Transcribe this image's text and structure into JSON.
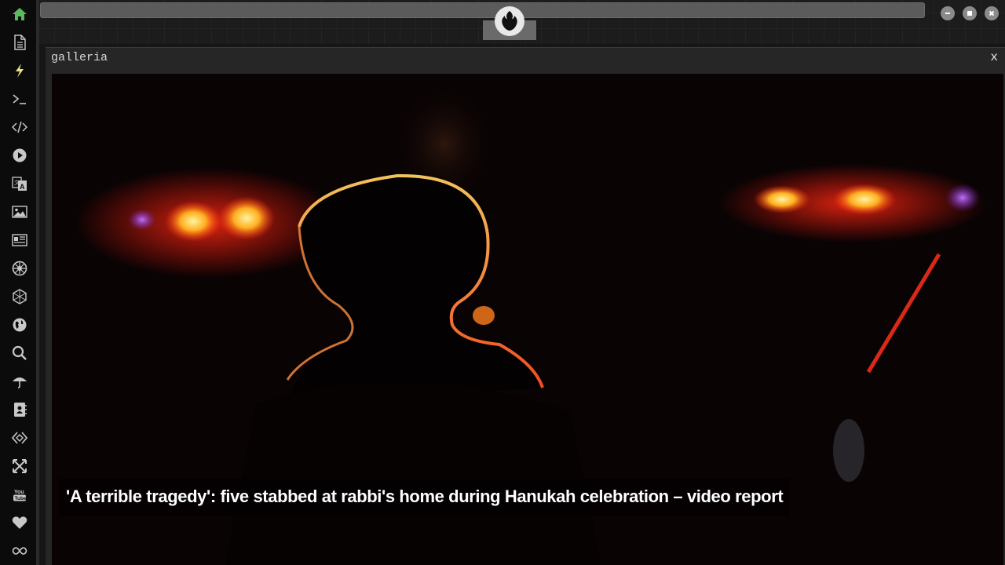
{
  "sidebar": {
    "items": [
      {
        "icon": "home-icon",
        "color": "#5cb85c"
      },
      {
        "icon": "document-icon"
      },
      {
        "icon": "lightning-icon",
        "color": "#f0e28a"
      },
      {
        "icon": "terminal-icon"
      },
      {
        "icon": "code-icon"
      },
      {
        "icon": "play-icon"
      },
      {
        "icon": "translate-icon"
      },
      {
        "icon": "image-icon"
      },
      {
        "icon": "news-icon"
      },
      {
        "icon": "empire-icon"
      },
      {
        "icon": "hexagon-icon"
      },
      {
        "icon": "globe-icon"
      },
      {
        "icon": "search-icon"
      },
      {
        "icon": "umbrella-icon"
      },
      {
        "icon": "address-book-icon"
      },
      {
        "icon": "diamond-code-icon"
      },
      {
        "icon": "expand-icon"
      },
      {
        "icon": "youtube-icon"
      },
      {
        "icon": "heart-icon"
      },
      {
        "icon": "infinity-icon"
      }
    ]
  },
  "topbar": {
    "address_value": "",
    "logo_icon": "rebel-alliance-icon"
  },
  "window": {
    "title": "galleria",
    "close_label": "x"
  },
  "gallery": {
    "caption": "'A terrible tragedy': five stabbed at rabbi's home during Hanukah celebration – video report"
  },
  "colors": {
    "accent_green": "#5cb85c",
    "lightning_yellow": "#f0e28a",
    "icon_default": "#c8c8c8"
  }
}
